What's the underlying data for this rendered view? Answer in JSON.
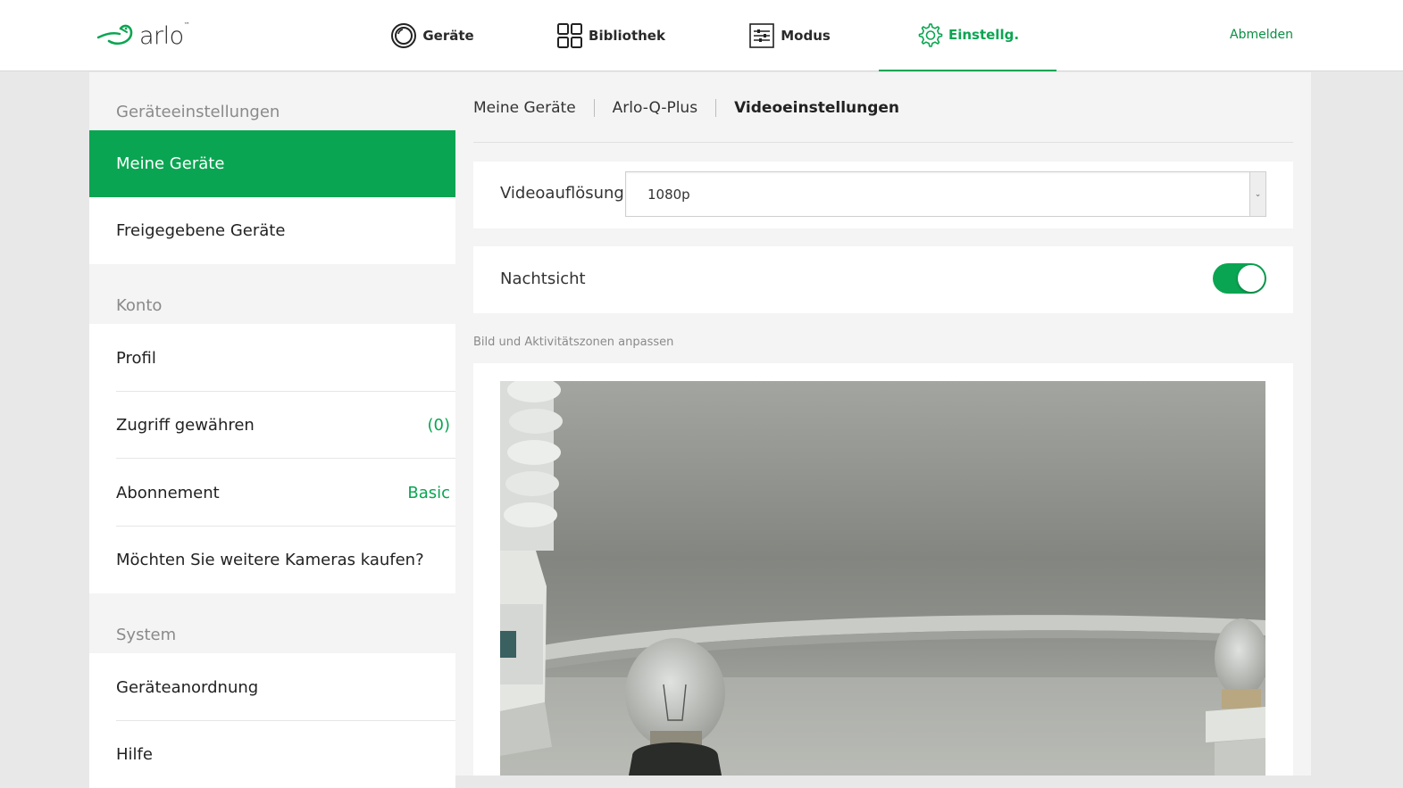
{
  "header": {
    "logo_text": "arlo",
    "logo_tm": "™",
    "nav": [
      {
        "label": "Geräte",
        "icon": "geraete-icon"
      },
      {
        "label": "Bibliothek",
        "icon": "grid-icon"
      },
      {
        "label": "Modus",
        "icon": "sliders-icon"
      },
      {
        "label": "Einstellg.",
        "icon": "gear-icon"
      }
    ],
    "logout": "Abmelden"
  },
  "sidebar": {
    "section_device": "Geräteeinstellungen",
    "items_device": [
      {
        "label": "Meine Geräte"
      },
      {
        "label": "Freigegebene Geräte"
      }
    ],
    "section_account": "Konto",
    "items_account": [
      {
        "label": "Profil"
      },
      {
        "label": "Zugriff gewähren",
        "value": "(0)"
      },
      {
        "label": "Abonnement",
        "value": "Basic"
      },
      {
        "label": "Möchten Sie weitere Kameras kaufen?"
      }
    ],
    "section_system": "System",
    "items_system": [
      {
        "label": "Geräteanordnung"
      },
      {
        "label": "Hilfe"
      }
    ]
  },
  "breadcrumb": [
    "Meine Geräte",
    "Arlo-Q-Plus",
    "Videoeinstellungen"
  ],
  "video_resolution": {
    "label": "Videoauflösung",
    "value": "1080p"
  },
  "night_vision": {
    "label": "Nachtsicht",
    "enabled": true
  },
  "image_hint": "Bild und Aktivitätszonen anpassen",
  "colors": {
    "accent": "#0aa552",
    "link": "#0a8f44"
  }
}
